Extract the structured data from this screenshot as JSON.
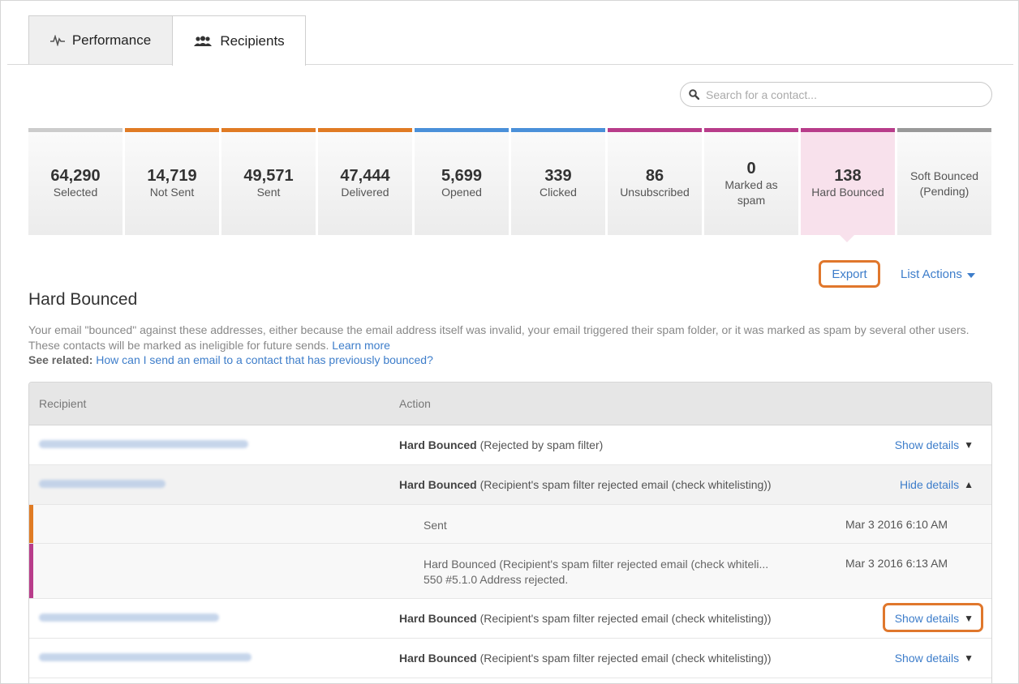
{
  "tabs": [
    {
      "label": "Performance",
      "icon": "pulse-icon",
      "active": false
    },
    {
      "label": "Recipients",
      "icon": "people-icon",
      "active": true
    }
  ],
  "search": {
    "placeholder": "Search for a contact..."
  },
  "stats": [
    {
      "value": "64,290",
      "label": "Selected",
      "color": "#cccccc"
    },
    {
      "value": "14,719",
      "label": "Not Sent",
      "color": "#e07b24"
    },
    {
      "value": "49,571",
      "label": "Sent",
      "color": "#e07b24"
    },
    {
      "value": "47,444",
      "label": "Delivered",
      "color": "#e07b24"
    },
    {
      "value": "5,699",
      "label": "Opened",
      "color": "#4a90d9"
    },
    {
      "value": "339",
      "label": "Clicked",
      "color": "#4a90d9"
    },
    {
      "value": "86",
      "label": "Unsubscribed",
      "color": "#b83c8a"
    },
    {
      "value": "0",
      "label": "Marked as spam",
      "color": "#b83c8a"
    },
    {
      "value": "138",
      "label": "Hard Bounced",
      "color": "#b83c8a",
      "active": true
    },
    {
      "value": "",
      "label": "Soft Bounced (Pending)",
      "color": "#999999"
    }
  ],
  "actions": {
    "export": "Export",
    "list_actions": "List Actions"
  },
  "section": {
    "title": "Hard Bounced",
    "description": "Your email \"bounced\" against these addresses, either because the email address itself was invalid, your email triggered their spam folder, or it was marked as spam by several other users. These contacts will be marked as ineligible for future sends.",
    "learn_more": "Learn more",
    "see_related_label": "See related:",
    "see_related_link": "How can I send an email to a contact that has previously bounced?"
  },
  "table": {
    "headers": {
      "recipient": "Recipient",
      "action": "Action"
    },
    "status_label": "Hard Bounced",
    "rows": [
      {
        "reason": "(Rejected by spam filter)",
        "toggle": "Show details",
        "arrow": "▼"
      },
      {
        "reason": "(Recipient's spam filter rejected email (check whitelisting))",
        "toggle": "Hide details",
        "arrow": "▲"
      },
      {
        "reason": "(Recipient's spam filter rejected email (check whitelisting))",
        "toggle": "Show details",
        "arrow": "▼"
      },
      {
        "reason": "(Recipient's spam filter rejected email (check whitelisting))",
        "toggle": "Show details",
        "arrow": "▼"
      }
    ],
    "details": [
      {
        "text": "Sent",
        "text2": "",
        "time": "Mar 3 2016 6:10 AM",
        "color": "#e07b24"
      },
      {
        "text": "Hard Bounced (Recipient's spam filter rejected email (check whiteli...",
        "text2": "550 #5.1.0 Address rejected.",
        "time": "Mar 3 2016 6:13 AM",
        "color": "#b83c8a"
      }
    ]
  }
}
